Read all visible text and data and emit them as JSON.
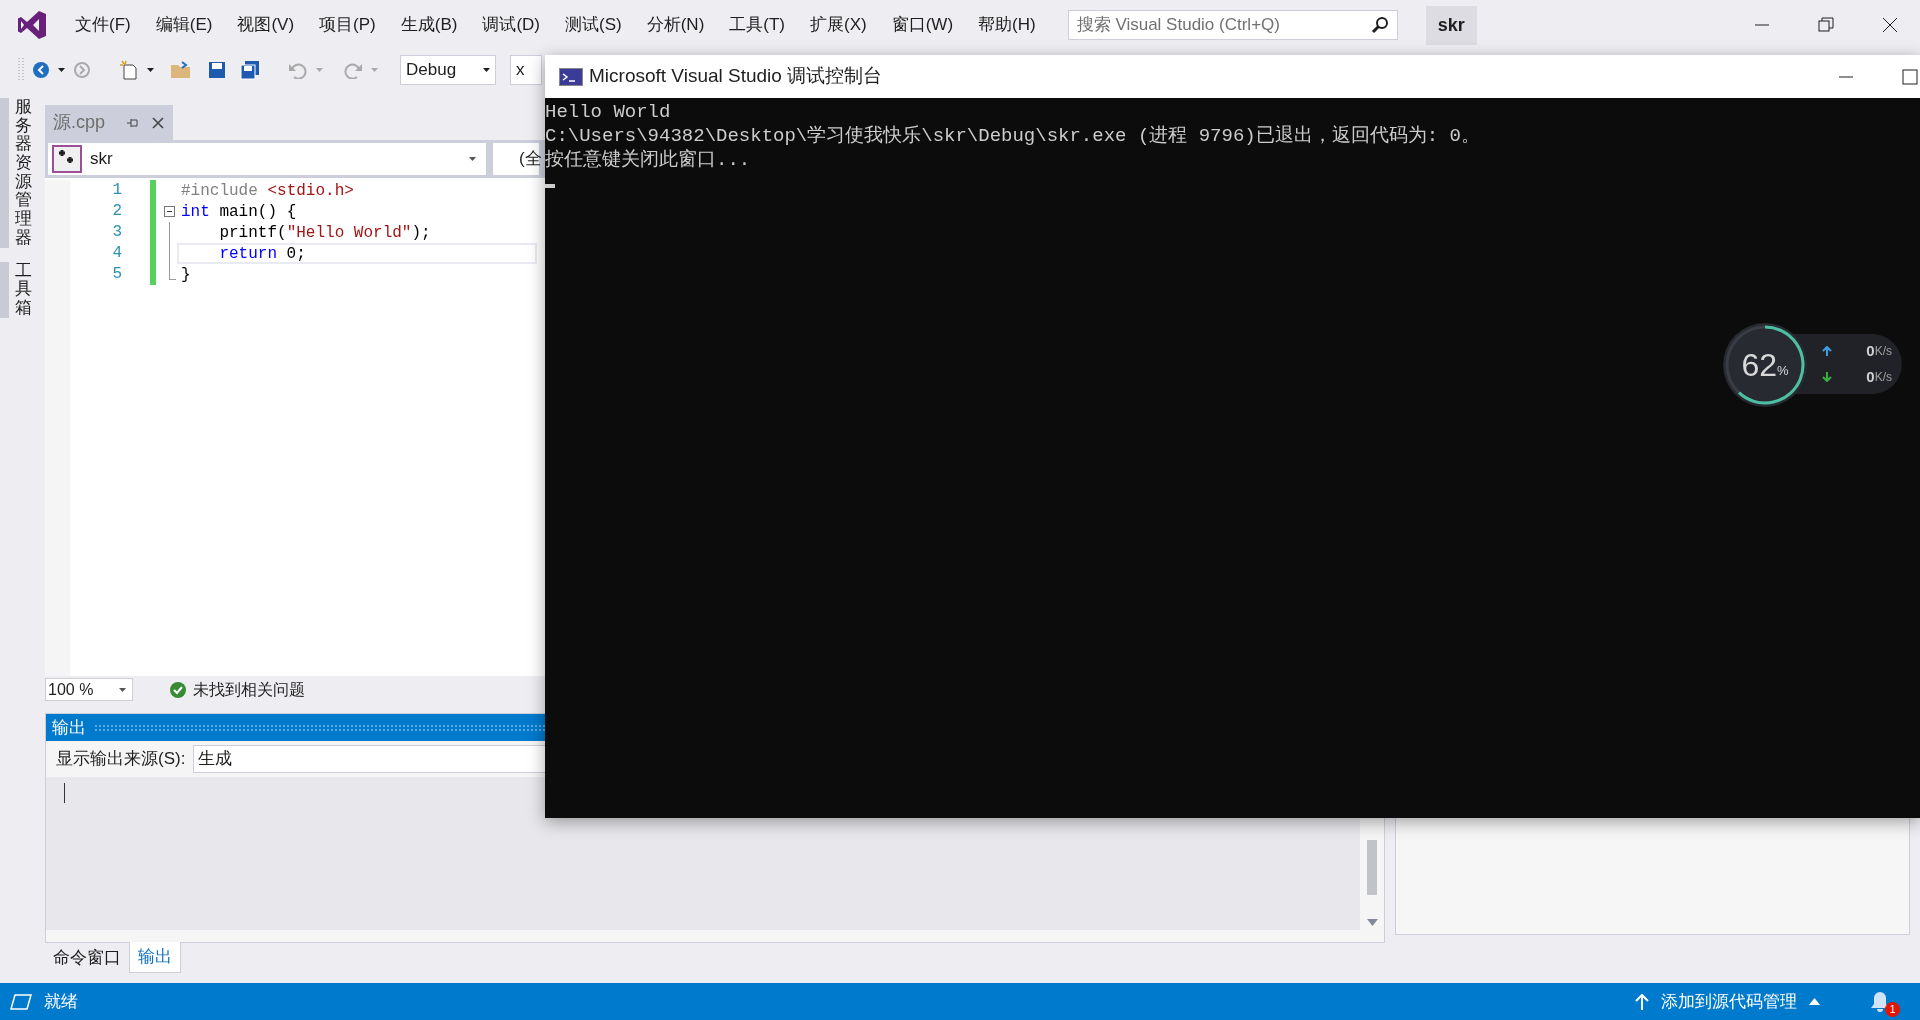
{
  "menu": [
    "文件(F)",
    "编辑(E)",
    "视图(V)",
    "项目(P)",
    "生成(B)",
    "调试(D)",
    "测试(S)",
    "分析(N)",
    "工具(T)",
    "扩展(X)",
    "窗口(W)",
    "帮助(H)"
  ],
  "search": {
    "placeholder": "搜索 Visual Studio (Ctrl+Q)"
  },
  "solution_name": "skr",
  "toolbar": {
    "configuration": "Debug",
    "platform": "x"
  },
  "side_tabs": [
    "服务器资源管理器",
    "工具箱"
  ],
  "document_tabs": [
    {
      "label": "源.cpp"
    }
  ],
  "nav_bar": {
    "project": "skr",
    "scope": "(全"
  },
  "editor": {
    "lines": [
      {
        "number": "1",
        "changed": true,
        "current": false,
        "kind": "plain",
        "tokens": [
          {
            "kind": "preproc",
            "text": "#include "
          },
          {
            "kind": "string",
            "text": "<stdio.h>"
          }
        ]
      },
      {
        "number": "2",
        "changed": true,
        "current": false,
        "kind": "fold-start",
        "tokens": [
          {
            "kind": "keyword",
            "text": "int"
          },
          {
            "kind": "plain",
            "text": " main() {"
          }
        ]
      },
      {
        "number": "3",
        "changed": true,
        "current": false,
        "kind": "fold-inner",
        "tokens": [
          {
            "kind": "plain",
            "text": "    printf("
          },
          {
            "kind": "string",
            "text": "\"Hello World\""
          },
          {
            "kind": "plain",
            "text": ");"
          }
        ]
      },
      {
        "number": "4",
        "changed": true,
        "current": true,
        "kind": "fold-inner",
        "tokens": [
          {
            "kind": "keyword",
            "text": "    return"
          },
          {
            "kind": "plain",
            "text": " 0;"
          }
        ]
      },
      {
        "number": "5",
        "changed": true,
        "current": false,
        "kind": "fold-end",
        "tokens": [
          {
            "kind": "plain",
            "text": "}"
          }
        ]
      }
    ],
    "zoom": "100 %",
    "issues": "未找到相关问题"
  },
  "output": {
    "title": "输出",
    "source_label": "显示输出来源(S):",
    "source": "生成"
  },
  "bottom_tabs": [
    {
      "label": "命令窗口",
      "selected": false
    },
    {
      "label": "输出",
      "selected": true
    }
  ],
  "status_bar": {
    "text": "就绪",
    "source_control": "添加到源代码管理",
    "notifications": "1"
  },
  "console": {
    "title": "Microsoft Visual Studio 调试控制台",
    "lines": [
      "Hello World",
      "C:\\Users\\94382\\Desktop\\学习使我快乐\\skr\\Debug\\skr.exe (进程 9796)已退出，返回代码为: 0。",
      "按任意键关闭此窗口..."
    ]
  },
  "net_monitor": {
    "usage": "62",
    "unit": "%",
    "upload": "0",
    "upload_unit": "K/s",
    "download": "0",
    "download_unit": "K/s"
  }
}
